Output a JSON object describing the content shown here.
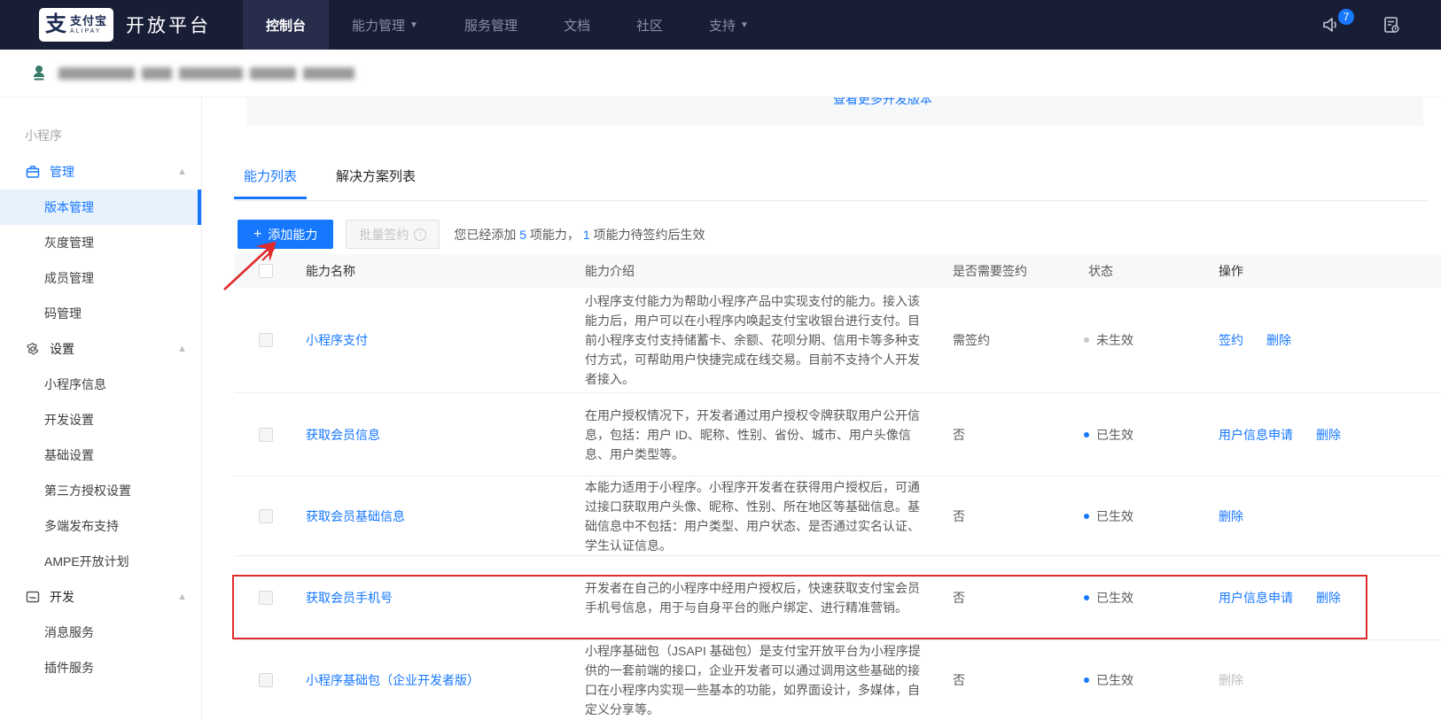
{
  "navbar": {
    "brand": {
      "logo_glyph": "支",
      "brand_cn": "支付宝",
      "brand_en": "ALIPAY",
      "platform": "开放平台"
    },
    "items": [
      {
        "label": "控制台",
        "active": true,
        "caret": false
      },
      {
        "label": "能力管理",
        "active": false,
        "caret": true
      },
      {
        "label": "服务管理",
        "active": false,
        "caret": false
      },
      {
        "label": "文档",
        "active": false,
        "caret": false
      },
      {
        "label": "社区",
        "active": false,
        "caret": false
      },
      {
        "label": "支持",
        "active": false,
        "caret": true
      }
    ],
    "notification_count": "7"
  },
  "sidebar": {
    "items": [
      {
        "type": "group",
        "label": "小程序"
      },
      {
        "type": "section",
        "label": "管理",
        "icon": "briefcase-icon",
        "accent": true
      },
      {
        "type": "item",
        "label": "版本管理",
        "active": true
      },
      {
        "type": "item",
        "label": "灰度管理"
      },
      {
        "type": "item",
        "label": "成员管理"
      },
      {
        "type": "item",
        "label": "码管理"
      },
      {
        "type": "section",
        "label": "设置",
        "icon": "gear-icon"
      },
      {
        "type": "item",
        "label": "小程序信息"
      },
      {
        "type": "item",
        "label": "开发设置"
      },
      {
        "type": "item",
        "label": "基础设置"
      },
      {
        "type": "item",
        "label": "第三方授权设置"
      },
      {
        "type": "item",
        "label": "多端发布支持"
      },
      {
        "type": "item",
        "label": "AMPE开放计划"
      },
      {
        "type": "section",
        "label": "开发",
        "icon": "window-icon"
      },
      {
        "type": "item",
        "label": "消息服务"
      },
      {
        "type": "item",
        "label": "插件服务"
      }
    ]
  },
  "main": {
    "more_versions_link": "查看更多开发版本",
    "tabs": [
      {
        "label": "能力列表",
        "active": true
      },
      {
        "label": "解决方案列表",
        "active": false
      }
    ],
    "toolbar": {
      "add_button": "添加能力",
      "batch_sign_button": "批量签约",
      "summary_prefix": "您已经添加 ",
      "summary_count_added": "5",
      "summary_mid": " 项能力， ",
      "summary_count_pending": "1",
      "summary_suffix": " 项能力待签约后生效"
    },
    "table": {
      "columns": [
        "能力名称",
        "能力介绍",
        "是否需要签约",
        "状态",
        "操作"
      ],
      "rows": [
        {
          "name": "小程序支付",
          "desc": "小程序支付能力为帮助小程序产品中实现支付的能力。接入该能力后，用户可以在小程序内唤起支付宝收银台进行支付。目前小程序支付支持储蓄卡、余额、花呗分期、信用卡等多种支付方式，可帮助用户快捷完成在线交易。目前不支持个人开发者接入。",
          "sign": "需签约",
          "status": "未生效",
          "status_active": false,
          "ops": [
            {
              "label": "签约",
              "disabled": false
            },
            {
              "label": "删除",
              "disabled": false
            }
          ],
          "highlighted": false
        },
        {
          "name": "获取会员信息",
          "desc": "在用户授权情况下，开发者通过用户授权令牌获取用户公开信息，包括：用户 ID、昵称、性别、省份、城市、用户头像信息、用户类型等。",
          "sign": "否",
          "status": "已生效",
          "status_active": true,
          "ops": [
            {
              "label": "用户信息申请",
              "disabled": false
            },
            {
              "label": "删除",
              "disabled": false
            }
          ],
          "highlighted": false
        },
        {
          "name": "获取会员基础信息",
          "desc": "本能力适用于小程序。小程序开发者在获得用户授权后，可通过接口获取用户头像、昵称、性别、所在地区等基础信息。基础信息中不包括：用户类型、用户状态、是否通过实名认证、学生认证信息。",
          "sign": "否",
          "status": "已生效",
          "status_active": true,
          "ops": [
            {
              "label": "删除",
              "disabled": false
            }
          ],
          "highlighted": false
        },
        {
          "name": "获取会员手机号",
          "desc": "开发者在自己的小程序中经用户授权后，快速获取支付宝会员手机号信息，用于与自身平台的账户绑定、进行精准营销。",
          "sign": "否",
          "status": "已生效",
          "status_active": true,
          "ops": [
            {
              "label": "用户信息申请",
              "disabled": false
            },
            {
              "label": "删除",
              "disabled": false
            }
          ],
          "highlighted": true
        },
        {
          "name": "小程序基础包（企业开发者版）",
          "desc": "小程序基础包（JSAPI 基础包）是支付宝开放平台为小程序提供的一套前端的接口，企业开发者可以通过调用这些基础的接口在小程序内实现一些基本的功能，如界面设计，多媒体，自定义分享等。",
          "sign": "否",
          "status": "已生效",
          "status_active": true,
          "ops": [
            {
              "label": "删除",
              "disabled": true
            }
          ],
          "highlighted": false
        }
      ]
    }
  },
  "colors": {
    "accent": "#1677ff",
    "annotation": "#e02b2b",
    "status_active_dot": "#1677ff",
    "status_inactive_dot": "#c8c8c8"
  }
}
